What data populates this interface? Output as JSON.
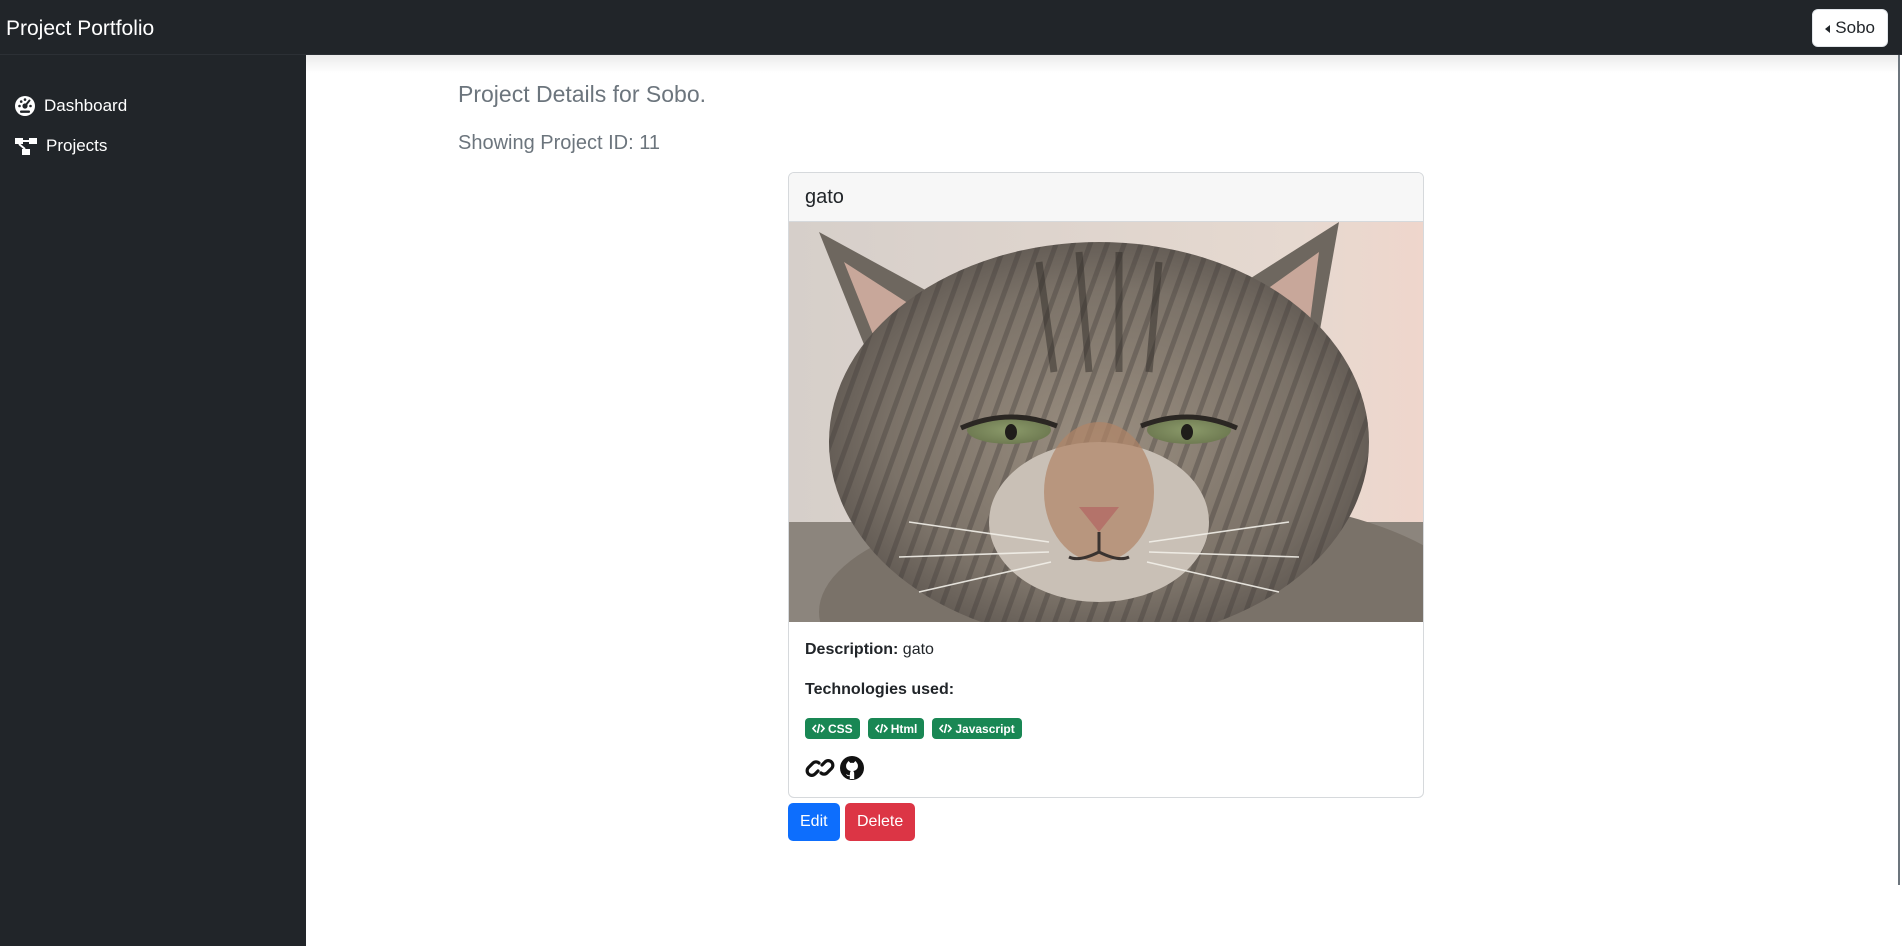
{
  "navbar": {
    "brand": "Project Portfolio",
    "user_button_label": "Sobo"
  },
  "sidebar": {
    "items": [
      {
        "label": "Dashboard",
        "icon": "dashboard-gauge-icon"
      },
      {
        "label": "Projects",
        "icon": "project-diagram-icon"
      }
    ]
  },
  "main": {
    "title": "Project Details for Sobo.",
    "subtitle": "Showing Project ID: 11"
  },
  "project": {
    "name": "gato",
    "image_subject": "tabby cat photo",
    "description_label": "Description:",
    "description": "gato",
    "technologies_label": "Technologies used:",
    "technologies": [
      "CSS",
      "Html",
      "Javascript"
    ],
    "links": [
      "link-icon",
      "github-icon"
    ]
  },
  "actions": {
    "edit_label": "Edit",
    "delete_label": "Delete"
  },
  "colors": {
    "navbar_bg": "#212529",
    "badge_bg": "#198754",
    "edit_bg": "#0d6efd",
    "delete_bg": "#dc3545",
    "muted_text": "#6c757d"
  }
}
